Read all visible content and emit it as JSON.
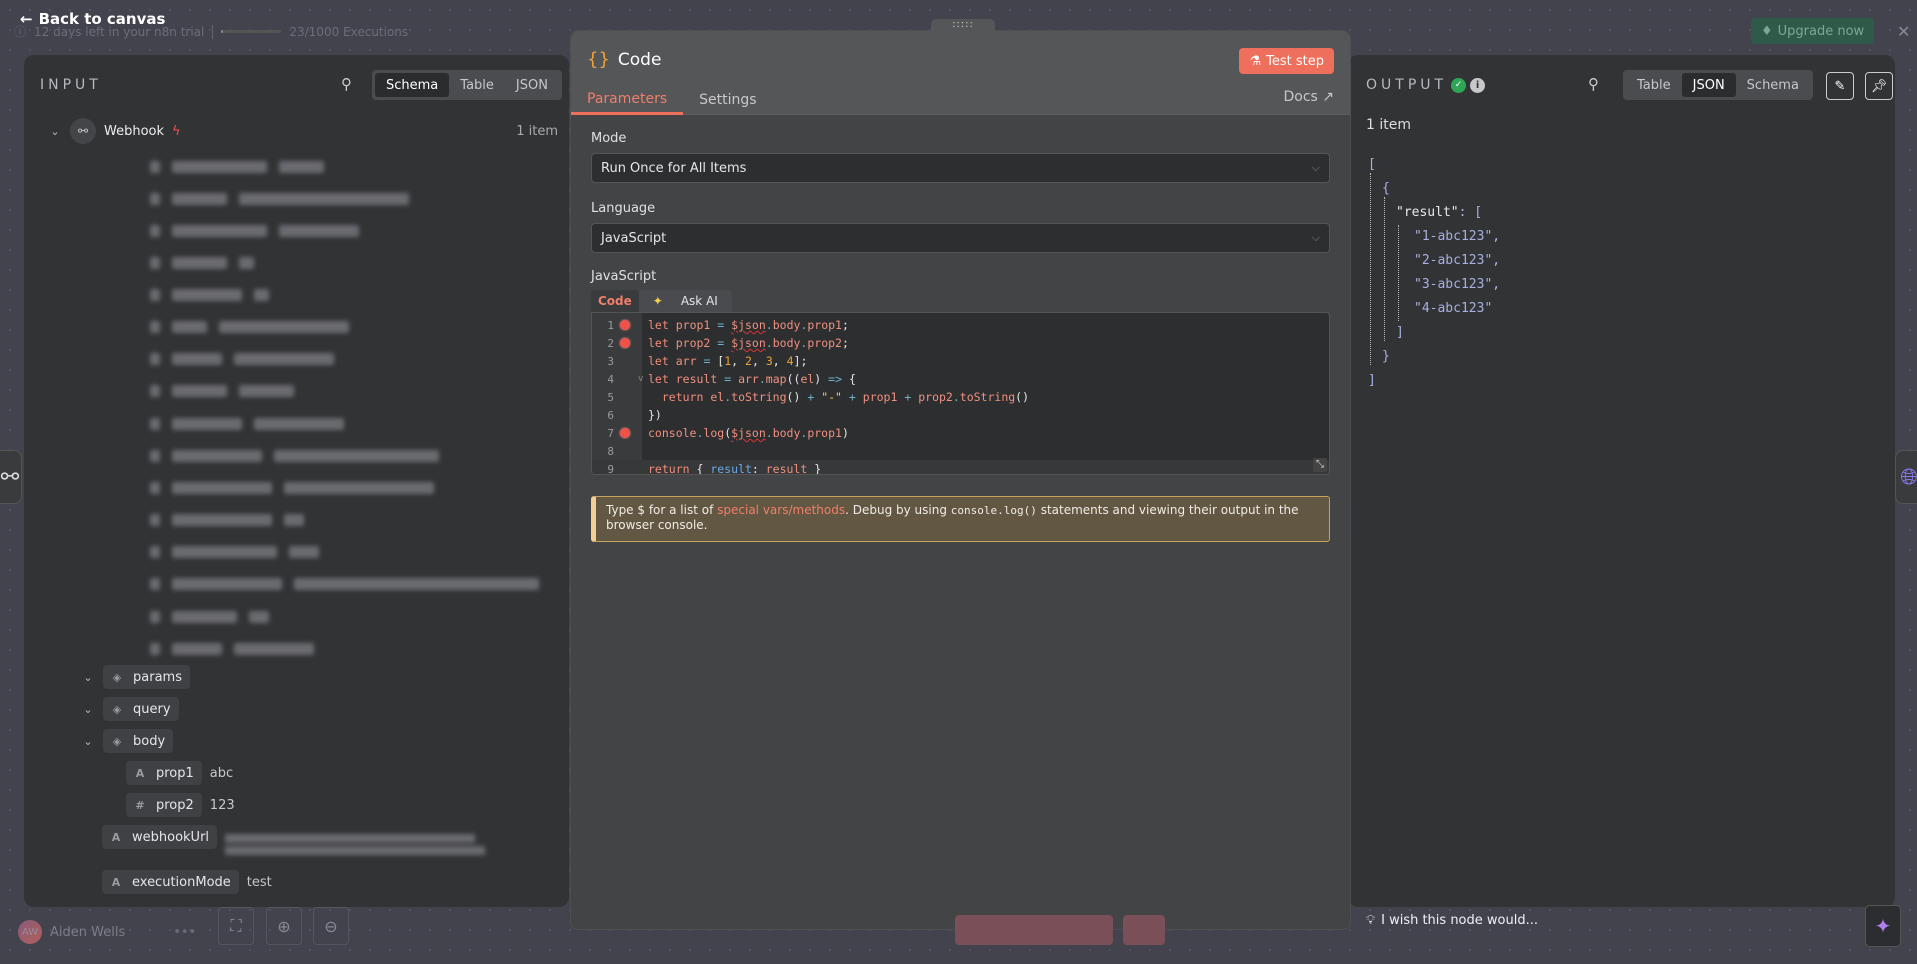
{
  "topbar": {
    "back_label": "Back to canvas",
    "trial_text": "12 days left in your n8n trial",
    "executions_text": "23/1000 Executions",
    "executions_fraction": 0.023,
    "upgrade_label": "Upgrade now"
  },
  "input": {
    "title": "INPUT",
    "view_tabs": [
      "Schema",
      "Table",
      "JSON"
    ],
    "active_view": "Schema",
    "node_name": "Webhook",
    "item_count": "1 item",
    "tree": [
      {
        "key": "params",
        "type": "object"
      },
      {
        "key": "query",
        "type": "object"
      },
      {
        "key": "body",
        "type": "object"
      },
      {
        "key": "prop1",
        "type": "string",
        "value": "abc"
      },
      {
        "key": "prop2",
        "type": "number",
        "value": "123"
      },
      {
        "key": "webhookUrl",
        "type": "string",
        "value": "[redacted]"
      },
      {
        "key": "executionMode",
        "type": "string",
        "value": "test"
      }
    ]
  },
  "node": {
    "title": "Code",
    "test_label": "Test step",
    "tabs": [
      "Parameters",
      "Settings"
    ],
    "active_tab": "Parameters",
    "docs_label": "Docs",
    "mode_label": "Mode",
    "mode_value": "Run Once for All Items",
    "language_label": "Language",
    "language_value": "JavaScript",
    "code_label": "JavaScript",
    "code_tabs": [
      "Code",
      "Ask AI"
    ],
    "breakpoints": [
      1,
      2,
      7
    ],
    "code_lines": [
      "let prop1 = $json.body.prop1;",
      "let prop2 = $json.body.prop2;",
      "let arr = [1, 2, 3, 4];",
      "let result = arr.map((el) => {",
      "  return el.toString() + \"-\" + prop1 + prop2.toString()",
      "})",
      "console.log($json.body.prop1)",
      "",
      "return { result: result }"
    ],
    "hint_pre": "Type $ for a list of ",
    "hint_link": "special vars/methods",
    "hint_mid": ". Debug by using ",
    "hint_code": "console.log()",
    "hint_post": " statements and viewing their output in the browser console."
  },
  "output": {
    "title": "OUTPUT",
    "view_tabs": [
      "Table",
      "JSON",
      "Schema"
    ],
    "active_view": "JSON",
    "item_count": "1 item",
    "json_key": "\"result\"",
    "json_values": [
      "\"1-abc123\",",
      "\"2-abc123\",",
      "\"3-abc123\",",
      "\"4-abc123\""
    ]
  },
  "footer": {
    "user_initials": "AW",
    "user_name": "Aiden Wells",
    "wish_text": "I wish this node would..."
  }
}
